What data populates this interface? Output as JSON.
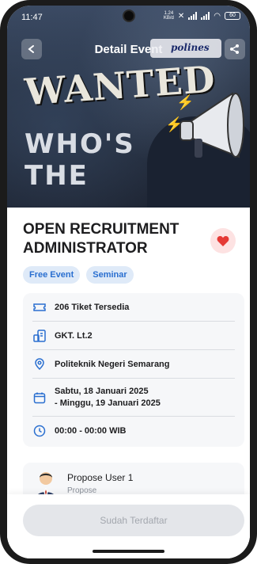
{
  "status_bar": {
    "time": "11:47",
    "speed_value": "1.24",
    "speed_unit": "KB/d",
    "battery": "60"
  },
  "nav": {
    "title": "Detail Event",
    "logo_text": "polines"
  },
  "banner": {
    "line1": "WANTED",
    "line2": "WHO'S",
    "line3": "THE"
  },
  "event": {
    "title": "OPEN RECRUITMENT ADMINISTRATOR",
    "favorited": true,
    "tags": [
      "Free Event",
      "Seminar"
    ]
  },
  "details": {
    "tickets": "206 Tiket Tersedia",
    "room": "GKT. Lt.2",
    "location": "Politeknik Negeri Semarang",
    "date_start": "Sabtu, 18 Januari 2025",
    "date_end": "- Minggu, 19 Januari 2025",
    "time": "00:00 - 00:00 WIB"
  },
  "proposer": {
    "name": "Propose User 1",
    "role": "Propose"
  },
  "action": {
    "label": "Sudah Terdaftar"
  },
  "colors": {
    "accent": "#2a6fd0",
    "heart": "#e53935",
    "chip_bg": "#dfeaf8"
  }
}
